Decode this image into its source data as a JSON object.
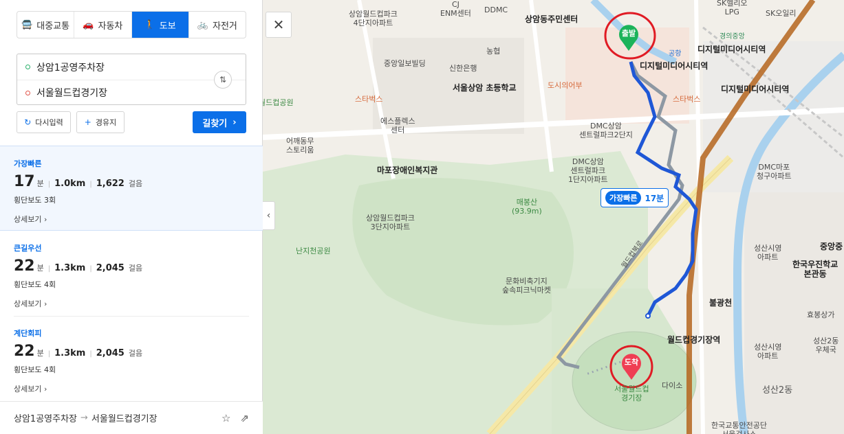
{
  "modes": [
    {
      "label": "대중교통",
      "icon": "bus-icon",
      "glyph": "🚍"
    },
    {
      "label": "자동차",
      "icon": "car-icon",
      "glyph": "🚗"
    },
    {
      "label": "도보",
      "icon": "walk-icon",
      "glyph": "🚶"
    },
    {
      "label": "자전거",
      "icon": "bike-icon",
      "glyph": "🚲"
    }
  ],
  "route": {
    "origin": "상암1공영주차장",
    "destination": "서울월드컵경기장",
    "reset_label": "다시입력",
    "waypoint_label": "경유지",
    "search_label": "길찾기"
  },
  "results": [
    {
      "tag": "가장빠른",
      "minutes": "17",
      "min_unit": "분",
      "distance": "1.0km",
      "steps": "1,622",
      "steps_unit": "걸음",
      "crossings": "횡단보도 3회",
      "detail": "상세보기"
    },
    {
      "tag": "큰길우선",
      "minutes": "22",
      "min_unit": "분",
      "distance": "1.3km",
      "steps": "2,045",
      "steps_unit": "걸음",
      "crossings": "횡단보도 4회",
      "detail": "상세보기"
    },
    {
      "tag": "계단회피",
      "minutes": "22",
      "min_unit": "분",
      "distance": "1.3km",
      "steps": "2,045",
      "steps_unit": "걸음",
      "crossings": "횡단보도 4회",
      "detail": "상세보기"
    }
  ],
  "footer": {
    "from": "상암1공영주차장",
    "to": "서울월드컵경기장"
  },
  "map": {
    "route_tag": {
      "label": "가장빠른",
      "time": "17분"
    },
    "start_pin": "출발",
    "end_pin": "도착",
    "labels": {
      "p1": "상암월드컵파크\n4단지아파트",
      "p2": "CJ\nENM센터",
      "p3": "DDMC",
      "p4": "상암동주민센터",
      "p5": "SK헬리오\nLPG",
      "p6": "SK오일리",
      "p7": "경의중앙",
      "p8": "공항",
      "p9": "디지털미디어시티역",
      "p10": "디지털미디어시티역",
      "p11": "디지털미디어시티역",
      "p12": "중앙일보빌딩",
      "p13": "농협",
      "p14": "신한은행",
      "p15": "서울상암 초등학교",
      "p16": "도시의어부",
      "p17": "스타벅스",
      "p18": "스타벅스",
      "p19": "월드컵공원",
      "p20": "에스플렉스\n센터",
      "p21": "DMC상암\n센트럴파크2단지",
      "p22": "어깨동무\n스토리움",
      "p23": "마포장애인복지관",
      "p24": "DMC상암\n센트럴파크\n1단지아파트",
      "p25": "DMC마포\n청구아파트",
      "p26": "매봉산\n(93.9m)",
      "p27": "상암월드컵파크\n3단지아파트",
      "p28": "난지천공원",
      "p29": "성산시영\n아파트",
      "p30": "한국우진학교\n본관동",
      "p31": "중앙중",
      "p32": "문화비축기지\n숲속피크닉마켓",
      "p33": "월드컵북로",
      "p34": "불광천",
      "p35": "효봉상가",
      "p36": "월드컵경기장역",
      "p37": "성산시영\n아파트",
      "p38": "성산2동\n우체국",
      "p39": "서울월드컵\n경기장",
      "p40": "다이소",
      "p41": "성산2동",
      "p42": "한국교통안전공단\n서울검사소"
    }
  }
}
